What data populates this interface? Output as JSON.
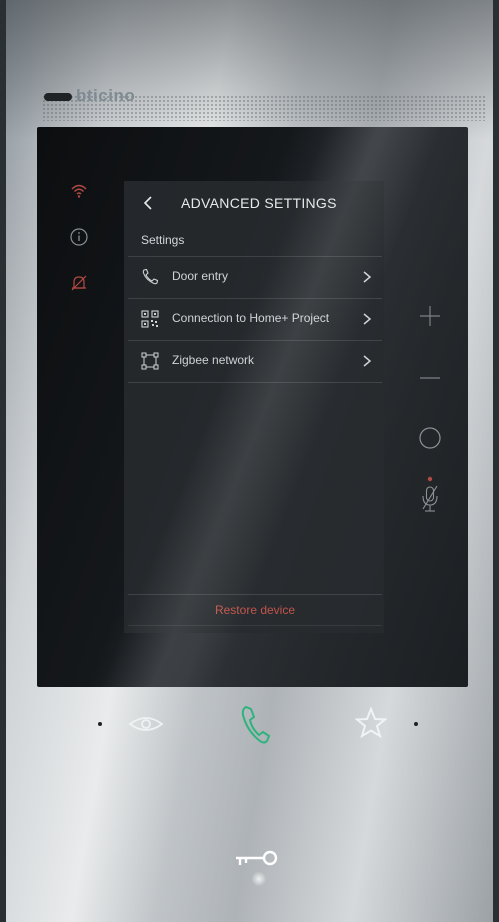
{
  "device": {
    "brand": "bticino"
  },
  "left_rail": {
    "icons": [
      "wifi-icon",
      "info-icon",
      "mute-bell-icon"
    ]
  },
  "panel": {
    "title": "ADVANCED SETTINGS",
    "section_label": "Settings",
    "items": [
      {
        "label": "Door entry",
        "icon": "phone-icon"
      },
      {
        "label": "Connection to Home+ Project",
        "icon": "qr-code-icon"
      },
      {
        "label": "Zigbee network",
        "icon": "network-frame-icon"
      }
    ],
    "restore_label": "Restore device"
  },
  "side_controls": [
    "plus-icon",
    "minus-icon",
    "circle-icon",
    "mic-off-icon"
  ],
  "hardware_buttons": [
    "eye-icon",
    "handset-icon",
    "star-icon",
    "key-icon"
  ],
  "colors": {
    "accent_red": "#c1554c",
    "handset_green": "#2fb37d",
    "text": "#cfd3d5"
  }
}
